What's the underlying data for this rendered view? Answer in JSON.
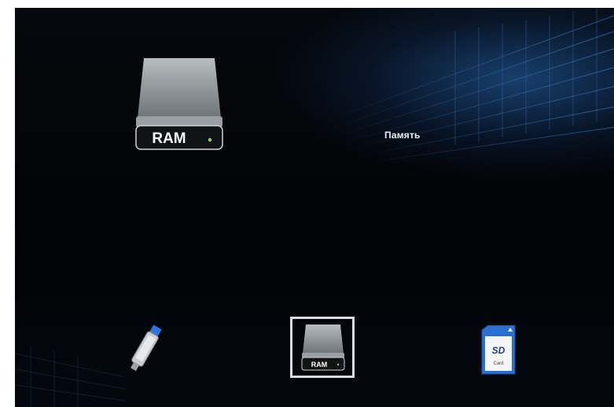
{
  "screen": {
    "title_label": "Память",
    "hero_icon": "ram-drive-icon",
    "hero_icon_text": "RAM",
    "tray": [
      {
        "icon": "usb-stick-icon",
        "selected": false
      },
      {
        "icon": "ram-drive-icon",
        "label": "RAM",
        "selected": true
      },
      {
        "icon": "sd-card-icon",
        "label": "Card",
        "selected": false
      }
    ]
  },
  "colors": {
    "accent_blue": "#2f6fb8",
    "selection_border": "#d8dde2",
    "drive_body": "#8f9498",
    "drive_plate": "#101214",
    "led_green": "#9bd35a"
  }
}
